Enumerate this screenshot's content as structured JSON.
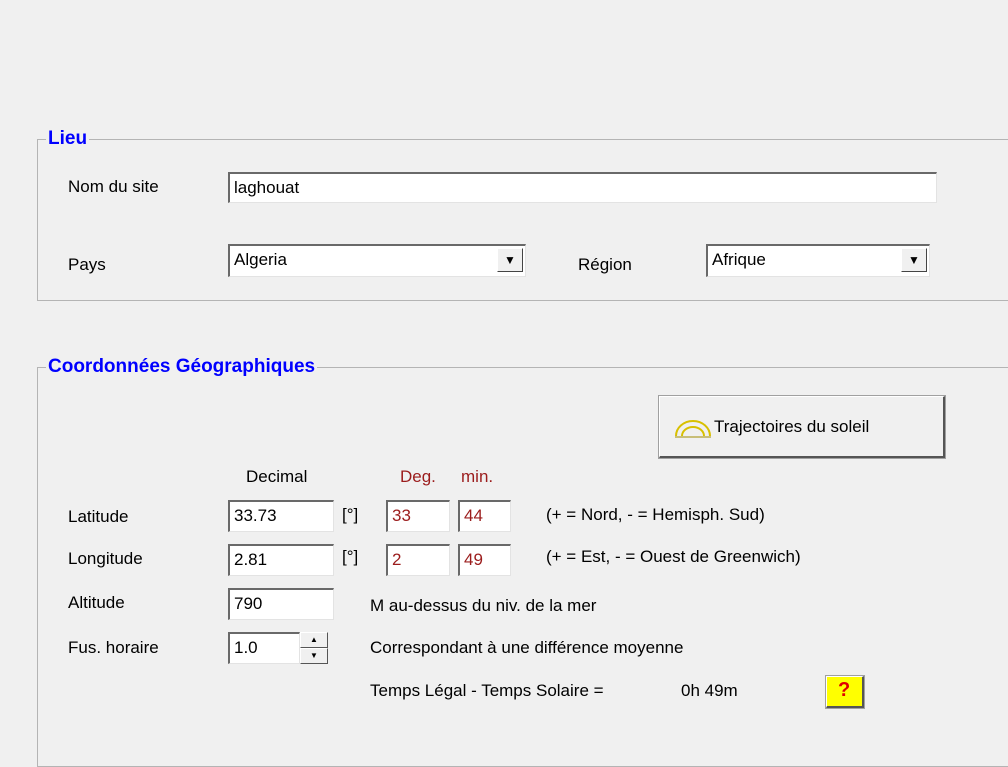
{
  "lieu": {
    "title": "Lieu",
    "nom_label": "Nom du site",
    "nom_value": "laghouat",
    "pays_label": "Pays",
    "pays_value": "Algeria",
    "region_label": "Région",
    "region_value": "Afrique"
  },
  "coords": {
    "title": "Coordonnées Géographiques",
    "sun_button_label": "Trajectoires du soleil",
    "hdr_decimal": "Decimal",
    "hdr_deg": "Deg.",
    "hdr_min": "min.",
    "unit_deg": "[°]",
    "latitude": {
      "label": "Latitude",
      "decimal": "33.73",
      "deg": "33",
      "min": "44",
      "note": "(+ = Nord,  - = Hemisph. Sud)"
    },
    "longitude": {
      "label": "Longitude",
      "decimal": "2.81",
      "deg": "2",
      "min": "49",
      "note": "(+ = Est, - = Ouest de Greenwich)"
    },
    "altitude": {
      "label": "Altitude",
      "value": "790",
      "note": "M au-dessus du niv. de la mer"
    },
    "fuseau": {
      "label": "Fus. horaire",
      "value": "1.0",
      "note": "Correspondant à une différence moyenne"
    },
    "temps": {
      "label": "Temps Légal - Temps Solaire =",
      "value": "0h 49m"
    },
    "help_label": "?"
  }
}
